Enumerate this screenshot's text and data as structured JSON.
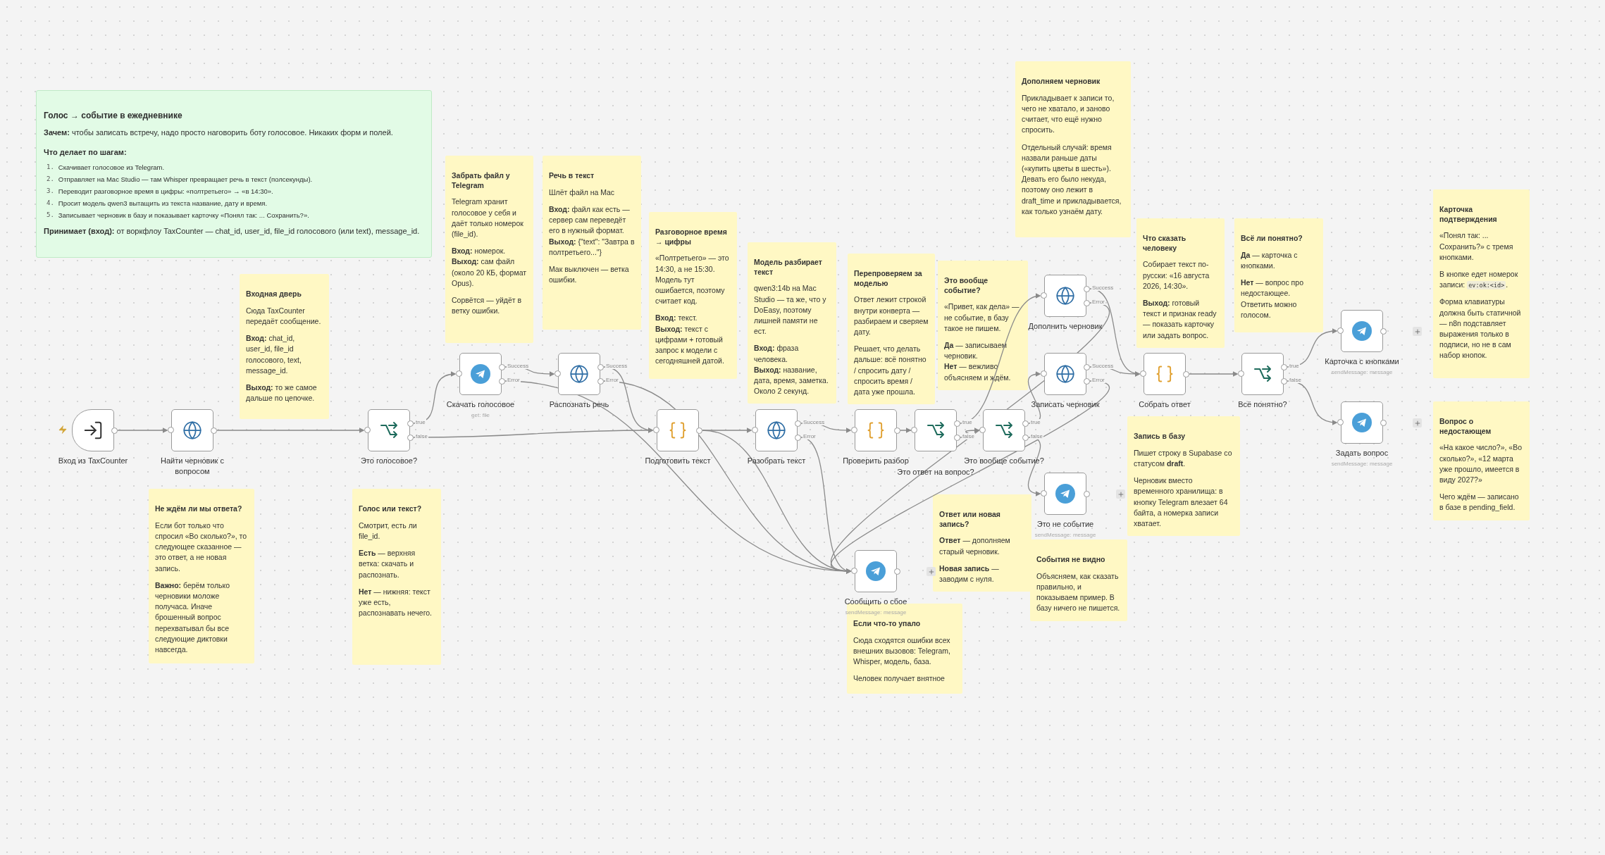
{
  "overview_note": {
    "title": "Голос → событие в ежедневнике",
    "intro": "**Зачем:** чтобы записать встречу, надо просто наговорить боту голосовое. Никаких форм и полей.",
    "steps_heading": "Что делает по шагам:",
    "steps": [
      {
        "number": "1.",
        "text": "Скачивает голосовое из Telegram."
      },
      {
        "number": "2.",
        "text": "Отправляет на Mac Studio — там Whisper превращает речь в текст (полсекунды)."
      },
      {
        "number": "3.",
        "text": "Переводит разговорное время в цифры: «полтретьего» → «в 14:30»."
      },
      {
        "number": "4.",
        "text": "Просит модель qwen3 вытащить из текста название, дату и время."
      },
      {
        "number": "5.",
        "text": "Записывает черновик в базу и показывает карточку «Понял так: ... Сохранить?»."
      }
    ],
    "input": "**Принимает (вход):** от воркфлоу TaxCounter — chat_id, user_id, file_id голосового (или text), message_id."
  },
  "sticky_notes": [
    {
      "title": "Входная дверь",
      "paragraphs": [
        "Сюда TaxCounter передаёт сообщение.",
        "**Вход:** chat_id, user_id, file_id голосового, text, message_id.",
        "**Выход:** то же самое дальше по цепочке."
      ]
    },
    {
      "title": "Забрать файл у Telegram",
      "paragraphs": [
        "Telegram хранит голосовое у себя и даёт только номерок (file_id).",
        "**Вход:** номерок.\n**Выход:** сам файл (около 20 КБ, формат Opus).",
        "Сорвётся — уйдёт в ветку ошибки."
      ]
    },
    {
      "title": "Речь в текст",
      "paragraphs": [
        "Шлёт файл на Mac",
        "**Вход:** файл как есть — сервер сам переведёт его в нужный формат.\n**Выход:** {\"text\": \"Завтра в полтретьего...\"}",
        "Мак выключен — ветка ошибки."
      ]
    },
    {
      "title": "Разговорное время → цифры",
      "paragraphs": [
        "«Полтретьего» — это 14:30, а не 15:30. Модель тут ошибается, поэтому считает код.",
        "**Вход:** текст.\n**Выход:** текст с цифрами + готовый запрос к модели с сегодняшней датой."
      ]
    },
    {
      "title": "Модель разбирает текст",
      "paragraphs": [
        "qwen3:14b на Mac Studio — та же, что у DoEasy, поэтому лишней памяти не ест.",
        "**Вход:** фраза человека.\n**Выход:** название, дата, время, заметка. Около 2 секунд."
      ]
    },
    {
      "title": "Перепроверяем за моделью",
      "paragraphs": [
        "Ответ лежит строкой внутри конверта — разбираем и сверяем дату.",
        "Решает, что делать дальше: всё понятно / спросить дату / спросить время / дата уже прошла."
      ]
    },
    {
      "title": "Это вообще событие?",
      "paragraphs": [
        "«Привет, как дела» — не событие, в базу такое не пишем.",
        "**Да** — записываем черновик.\n**Нет** — вежливо объясняем и ждём."
      ]
    },
    {
      "title": "Дополняем черновик",
      "paragraphs": [
        "Прикладывает к записи то, чего не хватало, и заново считает, что ещё нужно спросить.",
        "Отдельный случай: время назвали раньше даты («купить цветы в шесть»). Девать его было некуда, поэтому оно лежит в draft_time и прикладывается, как только узнаём дату."
      ]
    },
    {
      "title": "Что сказать человеку",
      "paragraphs": [
        "Собирает текст по-русски: «16 августа 2026, 14:30».",
        "**Выход:** готовый текст и признак ready — показать карточку или задать вопрос."
      ]
    },
    {
      "title": "Всё ли понятно?",
      "paragraphs": [
        "**Да** — карточка с кнопками.",
        "**Нет** — вопрос про недостающее. Ответить можно голосом."
      ]
    },
    {
      "title": "Карточка подтверждения",
      "paragraphs": [
        "«Понял так: ... Сохранить?» с тремя кнопками.",
        {
          "text": "В кнопке едет номерок записи: ",
          "code": "ev:ok:<id>",
          "after": "."
        },
        "Форма клавиатуры должна быть статичной — n8n подставляет выражения только в подписи, но не в сам набор кнопок."
      ]
    },
    {
      "title": "Вопрос о недостающем",
      "paragraphs": [
        "«На какое число?», «Во сколько?», «12 марта уже прошло, имеется в виду 2027?»",
        "Чего ждём — записано в базе в pending_field."
      ]
    },
    {
      "title": "Не ждём ли мы ответа?",
      "paragraphs": [
        "Если бот только что спросил «Во сколько?», то следующее сказанное — это ответ, а не новая запись.",
        "**Важно:** берём только черновики моложе получаса. Иначе брошенный вопрос перехватывал бы все следующие диктовки навсегда."
      ]
    },
    {
      "title": "Голос или текст?",
      "paragraphs": [
        "Смотрит, есть ли file_id.",
        "**Есть** — верхняя ветка: скачать и распознать.",
        "**Нет** — нижняя: текст уже есть, распознавать нечего."
      ]
    },
    {
      "title": "Ответ или новая запись?",
      "paragraphs": [
        "**Ответ** — дополняем старый черновик.",
        "**Новая запись** — заводим с нуля."
      ]
    },
    {
      "title": "Запись в базу",
      "paragraphs": [
        "Пишет строку в Supabase со статусом **draft**.",
        "Черновик вместо временного хранилища: в кнопку Telegram влезает 64 байта, а номерка записи хватает."
      ]
    },
    {
      "title": "События не видно",
      "paragraphs": [
        "Объясняем, как сказать правильно, и показываем пример. В базу ничего не пишется."
      ]
    },
    {
      "title": "Если что-то упало",
      "paragraphs": [
        "Сюда сходятся ошибки всех внешних вызовов: Telegram, Whisper, модель, база.",
        "Человек получает внятное"
      ]
    }
  ],
  "nodes": [
    {
      "label": "Вход из TaxCounter",
      "kind": "trigger"
    },
    {
      "label": "Найти черновик с вопросом",
      "kind": "http"
    },
    {
      "label": "Это голосовое?",
      "kind": "if",
      "outputs": [
        "true",
        "false"
      ]
    },
    {
      "label": "Скачать голосовое",
      "kind": "telegram",
      "subtitle": "get: file",
      "outputs": [
        "Success",
        "Error"
      ]
    },
    {
      "label": "Распознать речь",
      "kind": "http",
      "outputs": [
        "Success",
        "Error"
      ]
    },
    {
      "label": "Подготовить текст",
      "kind": "code"
    },
    {
      "label": "Разобрать текст",
      "kind": "http",
      "outputs": [
        "Success",
        "Error"
      ]
    },
    {
      "label": "Проверить разбор",
      "kind": "code"
    },
    {
      "label": "Это ответ на вопрос?",
      "kind": "if",
      "outputs": [
        "true",
        "false"
      ]
    },
    {
      "label": "Это вообще событие?",
      "kind": "if",
      "outputs": [
        "true",
        "false"
      ]
    },
    {
      "label": "Дополнить черновик",
      "kind": "http",
      "outputs": [
        "Success",
        "Error"
      ]
    },
    {
      "label": "Записать черновик",
      "kind": "http",
      "outputs": [
        "Success",
        "Error"
      ]
    },
    {
      "label": "Это не событие",
      "kind": "telegram",
      "subtitle": "sendMessage: message",
      "add_button": true
    },
    {
      "label": "Сообщить о сбое",
      "kind": "telegram",
      "subtitle": "sendMessage: message",
      "add_button": true
    },
    {
      "label": "Собрать ответ",
      "kind": "code"
    },
    {
      "label": "Всё понятно?",
      "kind": "if",
      "outputs": [
        "true",
        "false"
      ]
    },
    {
      "label": "Карточка с кнопками",
      "kind": "telegram",
      "subtitle": "sendMessage: message",
      "add_button": true
    },
    {
      "label": "Задать вопрос",
      "kind": "telegram",
      "subtitle": "sendMessage: message",
      "add_button": true
    }
  ]
}
